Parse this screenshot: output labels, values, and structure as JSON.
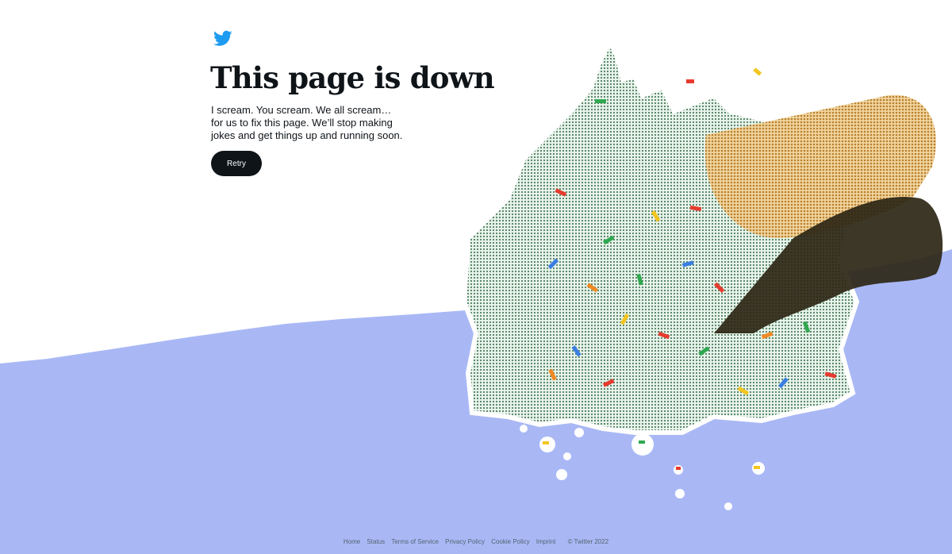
{
  "page": {
    "headline": "This page is down",
    "message": "I scream. You scream. We all scream… for us to fix this page. We’ll stop making jokes and get things up and running soon.",
    "retry_label": "Retry",
    "logo_icon": "twitter-bird-icon",
    "illustration": "melted-ice-cream-cone-illustration"
  },
  "footer": {
    "links": [
      "Home",
      "Status",
      "Terms of Service",
      "Privacy Policy",
      "Cookie Policy",
      "Imprint"
    ],
    "copyright": "© Twitter 2022"
  },
  "colors": {
    "brand_blue": "#1d9bf0",
    "floor_lavender": "#a9b8f5",
    "text_dark": "#0f1419",
    "button_bg": "#0f1419",
    "footer_text": "#536471",
    "ice_cream_mint": "#d5ecdf",
    "cone_tan": "#d8a64d"
  }
}
